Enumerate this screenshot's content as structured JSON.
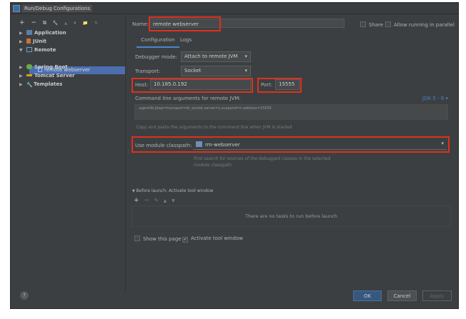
{
  "window": {
    "title": "Run/Debug Configurations"
  },
  "sidebar": {
    "toolbar": [
      "+",
      "−",
      "⧉",
      "🔧",
      "▲",
      "▼",
      "📁",
      "⇅"
    ],
    "tree": [
      {
        "label": "Application",
        "expanded": false,
        "icon": "application-icon"
      },
      {
        "label": "JUnit",
        "expanded": false,
        "icon": "junit-icon"
      },
      {
        "label": "Remote",
        "expanded": true,
        "icon": "remote-icon"
      },
      {
        "label": "remote webserver",
        "selected": true,
        "icon": "remote-config-icon"
      },
      {
        "label": "Spring Boot",
        "expanded": false,
        "icon": "spring-boot-icon"
      },
      {
        "label": "Tomcat Server",
        "expanded": false,
        "icon": "tomcat-icon"
      },
      {
        "label": "Templates",
        "expanded": false,
        "icon": "wrench-icon"
      }
    ]
  },
  "form": {
    "name_label": "Name:",
    "name_value": "remote webserver",
    "share_label": "Share",
    "parallel_label": "Allow running in parallel",
    "tabs": [
      "Configuration",
      "Logs"
    ],
    "debugger_mode_label": "Debugger mode:",
    "debugger_mode_value": "Attach to remote JVM",
    "transport_label": "Transport:",
    "transport_value": "Socket",
    "host_label": "Host:",
    "host_value": "10.185.0.192",
    "port_label": "Port:",
    "port_value": "15555",
    "cmd_label": "Command line arguments for remote JVM:",
    "jdk_label": "JDK 5 - 8 ▾",
    "cmd_value": "-agentlib:jdwp=transport=dt_socket,server=y,suspend=n,address=15555",
    "cmd_hint": "Copy and paste the arguments to the command line when JVM is started",
    "classpath_label": "Use module classpath:",
    "classpath_value": "rm-webserver",
    "classpath_hint_1": "First search for sources of the debugged classes in the selected",
    "classpath_hint_2": "module classpath",
    "before_launch_label": "Before launch: Activate tool window",
    "before_launch_empty": "There are no tasks to run before launch",
    "show_page_label": "Show this page",
    "activate_label": "Activate tool window",
    "show_page_checked": false,
    "activate_checked": true
  },
  "footer": {
    "help": "?",
    "ok": "OK",
    "cancel": "Cancel",
    "apply": "Apply"
  },
  "colors": {
    "accent": "#4b6eaf",
    "highlight": "#e0301e",
    "background": "#3c3f41"
  }
}
